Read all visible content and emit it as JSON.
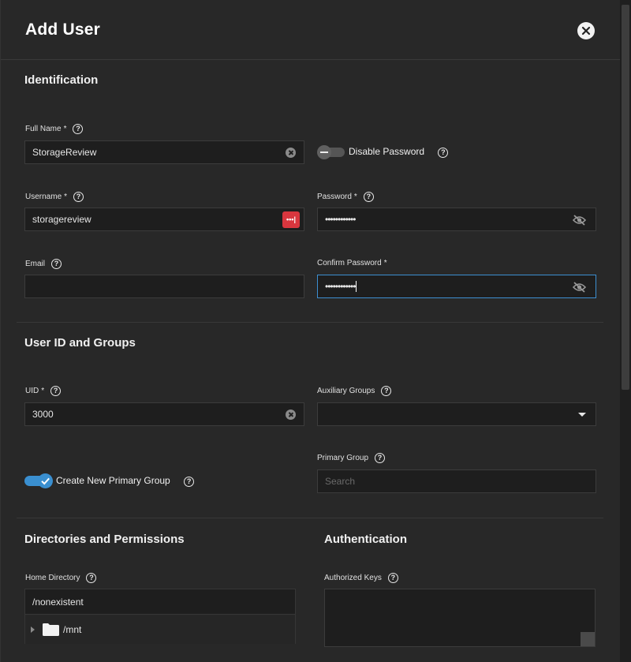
{
  "dialog": {
    "title": "Add User"
  },
  "identification": {
    "section_title": "Identification",
    "full_name": {
      "label": "Full Name",
      "required": "*",
      "value": "StorageReview"
    },
    "disable_password": {
      "label": "Disable Password",
      "checked": false
    },
    "username": {
      "label": "Username",
      "required": "*",
      "value": "storagereview",
      "password_manager_badge": "•••|"
    },
    "password": {
      "label": "Password",
      "required": "*",
      "value": "••••••••••••"
    },
    "email": {
      "label": "Email",
      "value": ""
    },
    "confirm_password": {
      "label": "Confirm Password",
      "required": "*",
      "value": "••••••••••••"
    }
  },
  "user_id_groups": {
    "section_title": "User ID and Groups",
    "uid": {
      "label": "UID",
      "required": "*",
      "value": "3000"
    },
    "auxiliary_groups": {
      "label": "Auxiliary Groups",
      "value": ""
    },
    "primary_group": {
      "label": "Primary Group",
      "placeholder": "Search"
    },
    "create_primary_group": {
      "label": "Create New Primary Group",
      "checked": true
    }
  },
  "directories": {
    "section_title": "Directories and Permissions",
    "home_directory": {
      "label": "Home Directory",
      "value": "/nonexistent"
    },
    "tree": [
      {
        "name": "/mnt",
        "expanded": false
      }
    ]
  },
  "authentication": {
    "section_title": "Authentication",
    "authorized_keys": {
      "label": "Authorized Keys",
      "value": ""
    }
  },
  "icons": {
    "help": "help-circle-icon",
    "close": "close-circle-icon",
    "clear": "clear-circle-icon",
    "visibility_off": "eye-off-icon",
    "folder": "folder-icon",
    "dropdown": "chevron-down-icon"
  },
  "colors": {
    "background": "#282828",
    "input_background": "#1e1e1e",
    "accent": "#3a8fd0",
    "password_badge": "#d9363e"
  }
}
